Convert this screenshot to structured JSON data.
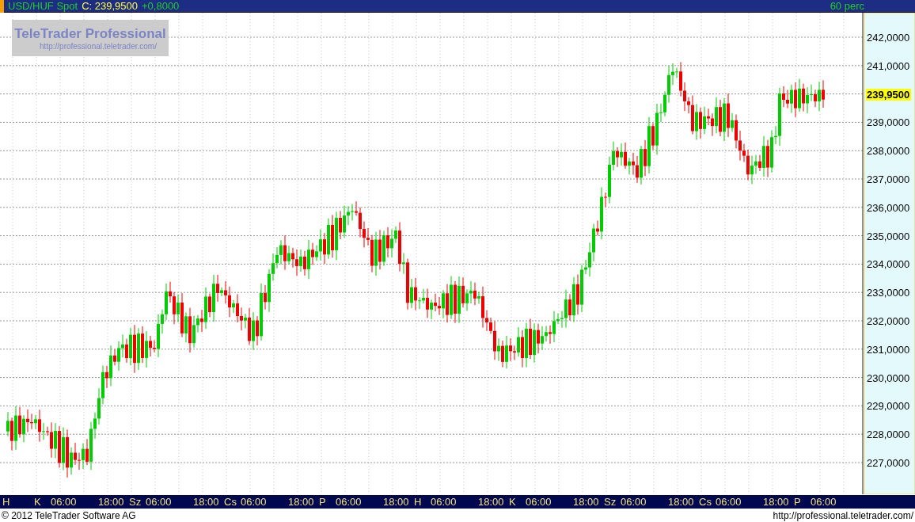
{
  "header": {
    "symbol": "USD/HUF Spot",
    "close_label": "C: 239,9500",
    "change": "+0,8000",
    "interval": "60 perc"
  },
  "logo": {
    "title": "TeleTrader Professional",
    "url": "http://professional.teletrader.com/"
  },
  "y_axis": {
    "ticks": [
      "242,0000",
      "241,0000",
      "239,0000",
      "238,0000",
      "237,0000",
      "236,0000",
      "235,0000",
      "234,0000",
      "233,0000",
      "232,0000",
      "231,0000",
      "230,0000",
      "229,0000",
      "228,0000",
      "227,0000"
    ],
    "current_price": "239,9500"
  },
  "x_axis": {
    "days": [
      {
        "label": "H"
      },
      {
        "label": "K",
        "times": [
          "06:00",
          "18:00"
        ]
      },
      {
        "label": "Sz",
        "times": [
          "06:00",
          "18:00"
        ]
      },
      {
        "label": "Cs",
        "times": [
          "06:00",
          "18:00"
        ]
      },
      {
        "label": "P",
        "times": [
          "06:00",
          "18:00"
        ]
      },
      {
        "label": "H",
        "times": [
          "06:00",
          "18:00"
        ]
      },
      {
        "label": "K",
        "times": [
          "06:00",
          "18:00"
        ]
      },
      {
        "label": "Sz",
        "times": [
          "06:00",
          "18:00"
        ]
      },
      {
        "label": "Cs",
        "times": [
          "06:00",
          "18:00"
        ]
      },
      {
        "label": "P",
        "times": [
          "06:00"
        ]
      }
    ]
  },
  "footer": {
    "copyright": "© 2012 TeleTrader Software AG",
    "url": "http://professional.teletrader.com/"
  }
}
